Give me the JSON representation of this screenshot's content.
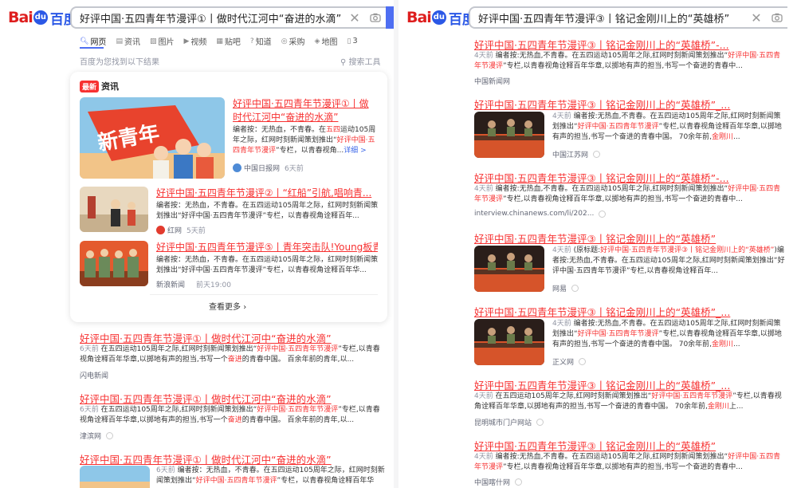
{
  "left": {
    "logo": {
      "bai": "Bai",
      "paw": "du",
      "cn": "百度"
    },
    "query": "好评中国·五四青年节漫评①丨做时代江河中“奋进的水滴”",
    "tabs": [
      "网页",
      "资讯",
      "图片",
      "视频",
      "贴吧",
      "知道",
      "采购",
      "地图",
      "3"
    ],
    "count": "百度为您找到以下结果",
    "tools": "搜索工具",
    "card": {
      "badge": "最新",
      "heading": "资讯",
      "items": [
        {
          "title": "好评中国·五四青年节漫评①丨做时代江河中“奋进的水滴”",
          "abstract_pre": "编者按：无热血，不青春。在",
          "abstract_red1": "五四",
          "abstract_mid": "运动105周年之际，红网时刻新闻策划推出“",
          "abstract_red2": "好评中国·五四青年节漫评",
          "abstract_post": "”专栏，以青春视角...",
          "more": "详细 >",
          "source": "中国日报网",
          "time": "6天前"
        },
        {
          "title": "好评中国·五四青年节漫评②丨“红船”引航,唱响青...",
          "abstract_pre": "编者按：无热血，不青春。在五四运动105周年之际，红网时刻新闻策划推出“好评中国·五四青年节漫评”专栏，以青春视角诠释百年...",
          "source": "红网",
          "time": "5天前"
        },
        {
          "title": "好评中国·五四青年节漫评⑤丨青年突击队!Young板青...",
          "abstract_pre": "编者按：无热血，不青春。在五四运动105周年之际，红网时刻新闻策划推出“好评中国·五四青年节漫评”专栏，以青春视角诠释百年华...",
          "source": "新浪新闻",
          "time": "前天19:00"
        }
      ],
      "see_more": "查看更多"
    },
    "results": [
      {
        "title": "好评中国·五四青年节漫评①丨做时代江河中“奋进的水滴”",
        "time": "6天前",
        "a1": "在五四运动105周年之际,红网时刻新闻策划推出“",
        "red": "好评中国·五四青年节漫评",
        "a2": "”专栏,以青春视角诠释百年华章,以掷地有声的担当,书写一个",
        "red2": "奋进",
        "a3": "的青春中国。 百余年前的青年,以...",
        "source": "闪电新闻"
      },
      {
        "title": "好评中国·五四青年节漫评①丨做时代江河中“奋进的水滴”",
        "time": "6天前",
        "a1": "在五四运动105周年之际,红网时刻新闻策划推出“",
        "red": "好评中国·五四青年节漫评",
        "a2": "”专栏,以青春视角诠释百年华章,以掷地有声的担当,书写一个",
        "red2": "奋进",
        "a3": "的青春中国。 百余年前的青年,以...",
        "source": "津滨网"
      },
      {
        "title": "好评中国·五四青年节漫评①丨做时代江河中“奋进的水滴”",
        "time": "6天前",
        "a1": "编者按：无热血，不青春。在五四运动105周年之际，红网时刻新闻策划推出“",
        "red": "好评中国·五四青年节漫评",
        "a2": "”专栏，以青春视角诠释百年华章，",
        "source": ""
      }
    ]
  },
  "right": {
    "query": "好评中国·五四青年节漫评③丨铭记金刚川上的“英雄桥”",
    "results": [
      {
        "title": "好评中国·五四青年节漫评③丨铭记金刚川上的“英雄桥”-...",
        "time": "4天前",
        "a1": "编者按:无热血,不青春。在五四运动105周年之际,红网时刻新闻策划推出“",
        "red": "好评中国·五四青年节漫评",
        "a2": "”专栏,以青春视角诠释百年华章,以掷地有声的担当,书写一个奋进的青春中...",
        "source": "中国新闻网",
        "image": false
      },
      {
        "title": "好评中国·五四青年节漫评③丨铭记金刚川上的“英雄桥”_...",
        "time": "4天前",
        "a1": "编者按:无热血,不青春。在五四运动105周年之际,红网时刻新闻策划推出“",
        "red": "好评中国·五四青年节漫评",
        "a2": "”专栏,以青春视角诠释百年华章,以掷地有声的担当,书写一个奋进的青春中国。 70余年前,",
        "red2": "金刚川",
        "a3": "...",
        "source": "中国江苏网",
        "image": true
      },
      {
        "title": "好评中国·五四青年节漫评③丨铭记金刚川上的“英雄桥”-...",
        "time": "4天前",
        "a1": "编者按:无热血,不青春。在五四运动105周年之际,红网时刻新闻策划推出“",
        "red": "好评中国·五四青年节漫评",
        "a2": "”专栏,以青春视角诠释百年华章,以掷地有声的担当,书写一个奋进的青春中...",
        "source": "interview.chinanews.com/li/202...",
        "image": false
      },
      {
        "title": "好评中国·五四青年节漫评③丨铭记金刚川上的“英雄桥”",
        "time": "4天前",
        "a1": "(原标题:",
        "red": "好评中国·五四青年节漫评③丨铭记金刚川上的“英雄桥”",
        "a2": ")编者按:无热血,不青春。在五四运动105周年之际,红网时刻新闻策划推出“好评中国·五四青年节漫评”专栏,以青春视角诠释百年...",
        "source": "网易",
        "image": true
      },
      {
        "title": "好评中国·五四青年节漫评③丨铭记金刚川上的“英雄桥”_...",
        "time": "4天前",
        "a1": "编者按:无热血,不青春。在五四运动105周年之际,红网时刻新闻策划推出“",
        "red": "好评中国·五四青年节漫评",
        "a2": "”专栏,以青春视角诠释百年华章,以掷地有声的担当,书写一个奋进的青春中国。 70余年前,",
        "red2": "金刚川",
        "a3": "...",
        "source": "正义网",
        "image": true
      },
      {
        "title": "好评中国·五四青年节漫评③丨铭记金刚川上的“英雄桥”_...",
        "time": "4天前",
        "a1": "在五四运动105周年之际,红网时刻新闻策划推出“",
        "red": "好评中国·五四青年节漫评",
        "a2": "”专栏,以青春视角诠释百年华章,以掷地有声的担当,书写一个奋进的青春中国。 70余年前,",
        "red2": "金刚川",
        "a3": "上...",
        "source": "昆明城市门户网站",
        "image": false
      },
      {
        "title": "好评中国·五四青年节漫评③丨铭记金刚川上的“英雄桥”",
        "time": "4天前",
        "a1": "编者按:无热血,不青春。在五四运动105周年之际,红网时刻新闻策划推出“",
        "red": "好评中国·五四青年节漫评",
        "a2": "”专栏,以青春视角诠释百年华章,以掷地有声的担当,书写一个奋进的青春中...",
        "source": "中国喀什网",
        "image": false
      }
    ]
  },
  "colors": {
    "accent": "#4e6ef2",
    "title_red": "#f73131",
    "logo_red": "#de1e1e",
    "logo_blue": "#2b58e6"
  }
}
